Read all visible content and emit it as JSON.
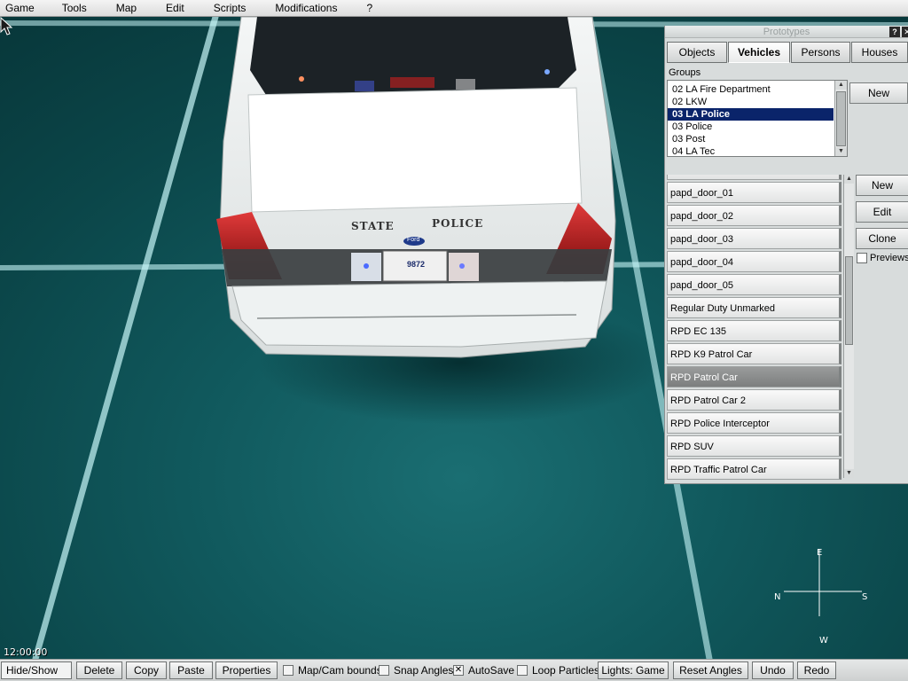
{
  "menu": {
    "items": [
      {
        "label": "Game",
        "key": "G"
      },
      {
        "label": "Tools",
        "key": "T"
      },
      {
        "label": "Map",
        "key": "M"
      },
      {
        "label": "Edit",
        "key": "E"
      },
      {
        "label": "Scripts",
        "key": "S"
      },
      {
        "label": "Modifications",
        "key": "M"
      },
      {
        "label": "?",
        "key": "?"
      }
    ]
  },
  "viewport": {
    "time": "12:00:00",
    "compass": {
      "north": "E",
      "west": "N",
      "east": "S",
      "south": "W"
    },
    "car": {
      "decal_left": "STATE",
      "decal_right": "POLICE",
      "plate": "9872",
      "badge": "Ford"
    }
  },
  "prototypes": {
    "title": "Prototypes",
    "help_label": "?",
    "close_label": "✕",
    "tabs": [
      {
        "label": "Objects",
        "active": false
      },
      {
        "label": "Vehicles",
        "active": true
      },
      {
        "label": "Persons",
        "active": false
      },
      {
        "label": "Houses",
        "active": false
      }
    ],
    "groups_label": "Groups",
    "groups": [
      {
        "label": "02 LA Fire Department",
        "selected": false
      },
      {
        "label": "02 LKW",
        "selected": false
      },
      {
        "label": "03 LA Police",
        "selected": true
      },
      {
        "label": "03 Police",
        "selected": false
      },
      {
        "label": "03 Post",
        "selected": false
      },
      {
        "label": "04 LA Tec",
        "selected": false
      }
    ],
    "groups_new_label": "New",
    "items": [
      {
        "label": "",
        "selected": false
      },
      {
        "label": "papd_door_01",
        "selected": false
      },
      {
        "label": "papd_door_02",
        "selected": false
      },
      {
        "label": "papd_door_03",
        "selected": false
      },
      {
        "label": "papd_door_04",
        "selected": false
      },
      {
        "label": "papd_door_05",
        "selected": false
      },
      {
        "label": "Regular Duty Unmarked",
        "selected": false
      },
      {
        "label": "RPD EC 135",
        "selected": false
      },
      {
        "label": "RPD K9 Patrol Car",
        "selected": false
      },
      {
        "label": "RPD Patrol Car",
        "selected": true
      },
      {
        "label": "RPD Patrol Car 2",
        "selected": false
      },
      {
        "label": "RPD Police Interceptor",
        "selected": false
      },
      {
        "label": "RPD SUV",
        "selected": false
      },
      {
        "label": "RPD Traffic Patrol Car",
        "selected": false
      }
    ],
    "actions": {
      "new_label": "New",
      "edit_label": "Edit",
      "clone_label": "Clone"
    },
    "previews_label": "Previews",
    "previews_checked": false
  },
  "toolbar": {
    "hide_show_label": "Hide/Show",
    "delete_label": "Delete",
    "copy_label": "Copy",
    "paste_label": "Paste",
    "properties_label": "Properties",
    "map_cam_bounds_label": "Map/Cam bounds",
    "map_cam_bounds_checked": false,
    "snap_angles_label": "Snap Angles",
    "snap_angles_checked": false,
    "autosave_label": "AutoSave",
    "autosave_checked": true,
    "loop_particles_label": "Loop Particles",
    "loop_particles_checked": false,
    "lights_label": "Lights: Game",
    "reset_angles_label": "Reset Angles",
    "undo_label": "Undo",
    "redo_label": "Redo"
  }
}
